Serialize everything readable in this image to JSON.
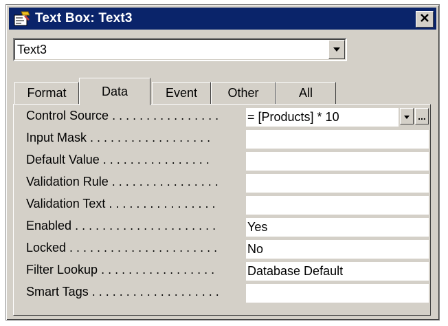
{
  "window": {
    "title": "Text Box: Text3",
    "colors": {
      "titlebar": "#0a246a",
      "face": "#d4d0c8"
    }
  },
  "selector": {
    "value": "Text3",
    "dropdown_icon": "chevron-down-icon"
  },
  "tabs": [
    {
      "label": "Format",
      "active": false
    },
    {
      "label": "Data",
      "active": true
    },
    {
      "label": "Event",
      "active": false
    },
    {
      "label": "Other",
      "active": false
    },
    {
      "label": "All",
      "active": false
    }
  ],
  "properties": [
    {
      "label": "Control Source",
      "value": "= [Products] * 10"
    },
    {
      "label": "Input Mask",
      "value": ""
    },
    {
      "label": "Default Value",
      "value": ""
    },
    {
      "label": "Validation Rule",
      "value": ""
    },
    {
      "label": "Validation Text",
      "value": ""
    },
    {
      "label": "Enabled",
      "value": "Yes"
    },
    {
      "label": "Locked",
      "value": "No"
    },
    {
      "label": "Filter Lookup",
      "value": "Database Default"
    },
    {
      "label": "Smart Tags",
      "value": ""
    }
  ],
  "builder_button_label": "..."
}
